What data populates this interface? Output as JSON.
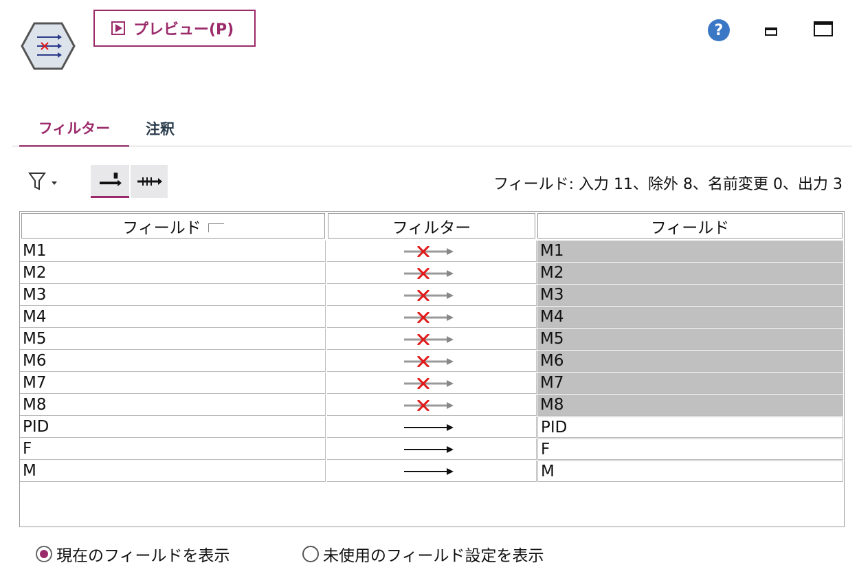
{
  "header": {
    "preview_label": "プレビュー(P)",
    "help_label": "?"
  },
  "tabs": [
    {
      "label": "フィルター",
      "active": true
    },
    {
      "label": "注釈",
      "active": false
    }
  ],
  "toolbar": {
    "field_stats": "フィールド: 入力 11、除外 8、名前変更 0、出力 3"
  },
  "table": {
    "headers": [
      "フィールド",
      "フィルター",
      "フィールド"
    ],
    "rows": [
      {
        "input": "M1",
        "output": "M1",
        "excluded": true
      },
      {
        "input": "M2",
        "output": "M2",
        "excluded": true
      },
      {
        "input": "M3",
        "output": "M3",
        "excluded": true
      },
      {
        "input": "M4",
        "output": "M4",
        "excluded": true
      },
      {
        "input": "M5",
        "output": "M5",
        "excluded": true
      },
      {
        "input": "M6",
        "output": "M6",
        "excluded": true
      },
      {
        "input": "M7",
        "output": "M7",
        "excluded": true
      },
      {
        "input": "M8",
        "output": "M8",
        "excluded": true
      },
      {
        "input": "PID",
        "output": "PID",
        "excluded": false
      },
      {
        "input": "F",
        "output": "F",
        "excluded": false
      },
      {
        "input": "M",
        "output": "M",
        "excluded": false
      }
    ]
  },
  "radios": [
    {
      "label": "現在のフィールドを表示",
      "checked": true
    },
    {
      "label": "未使用のフィールド設定を表示",
      "checked": false
    }
  ],
  "colors": {
    "accent": "#9b2a6a",
    "excluded_bg": "#c0c0c0",
    "help": "#3a78c6",
    "cross": "#e01818"
  }
}
